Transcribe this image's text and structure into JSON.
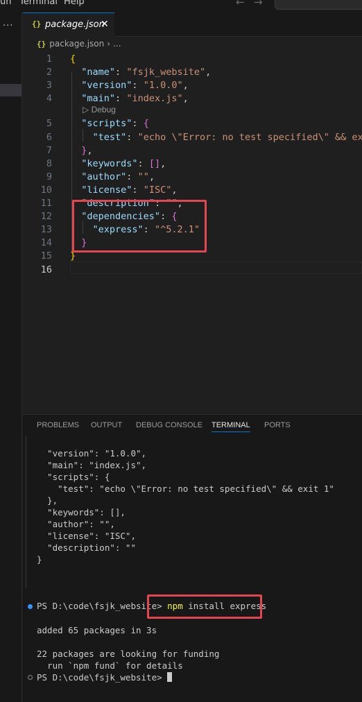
{
  "menu": {
    "run": "un",
    "terminal": "Terminal",
    "help": "Help"
  },
  "nav": {
    "back": "←",
    "forward": "→"
  },
  "sidebar": {
    "more": "..."
  },
  "tab": {
    "icon": "{}",
    "label": "package.json",
    "close": "✕"
  },
  "breadcrumb": {
    "icon": "{}",
    "file": "package.json",
    "sep": "›",
    "more": "..."
  },
  "codelens": {
    "debug": "Debug"
  },
  "editor_lines": [
    {
      "n": "1",
      "tokens": [
        {
          "t": "{",
          "c": "b1"
        }
      ]
    },
    {
      "n": "2",
      "tokens": [
        {
          "t": "  ",
          "c": "p"
        },
        {
          "t": "\"name\"",
          "c": "k"
        },
        {
          "t": ": ",
          "c": "p"
        },
        {
          "t": "\"fsjk_website\"",
          "c": "s"
        },
        {
          "t": ",",
          "c": "p"
        }
      ]
    },
    {
      "n": "3",
      "tokens": [
        {
          "t": "  ",
          "c": "p"
        },
        {
          "t": "\"version\"",
          "c": "k"
        },
        {
          "t": ": ",
          "c": "p"
        },
        {
          "t": "\"1.0.0\"",
          "c": "s"
        },
        {
          "t": ",",
          "c": "p"
        }
      ]
    },
    {
      "n": "4",
      "tokens": [
        {
          "t": "  ",
          "c": "p"
        },
        {
          "t": "\"main\"",
          "c": "k"
        },
        {
          "t": ": ",
          "c": "p"
        },
        {
          "t": "\"index.js\"",
          "c": "s"
        },
        {
          "t": ",",
          "c": "p"
        }
      ]
    },
    {
      "n": "5",
      "tokens": [
        {
          "t": "  ",
          "c": "p"
        },
        {
          "t": "\"scripts\"",
          "c": "k"
        },
        {
          "t": ": ",
          "c": "p"
        },
        {
          "t": "{",
          "c": "b2"
        }
      ]
    },
    {
      "n": "6",
      "tokens": [
        {
          "t": "    ",
          "c": "p"
        },
        {
          "t": "\"test\"",
          "c": "k"
        },
        {
          "t": ": ",
          "c": "p"
        },
        {
          "t": "\"echo \\\"Error: no test specified\\\" && exit",
          "c": "s"
        }
      ]
    },
    {
      "n": "7",
      "tokens": [
        {
          "t": "  ",
          "c": "p"
        },
        {
          "t": "}",
          "c": "b2"
        },
        {
          "t": ",",
          "c": "p"
        }
      ]
    },
    {
      "n": "8",
      "tokens": [
        {
          "t": "  ",
          "c": "p"
        },
        {
          "t": "\"keywords\"",
          "c": "k"
        },
        {
          "t": ": ",
          "c": "p"
        },
        {
          "t": "[]",
          "c": "b2"
        },
        {
          "t": ",",
          "c": "p"
        }
      ]
    },
    {
      "n": "9",
      "tokens": [
        {
          "t": "  ",
          "c": "p"
        },
        {
          "t": "\"author\"",
          "c": "k"
        },
        {
          "t": ": ",
          "c": "p"
        },
        {
          "t": "\"\"",
          "c": "s"
        },
        {
          "t": ",",
          "c": "p"
        }
      ]
    },
    {
      "n": "10",
      "tokens": [
        {
          "t": "  ",
          "c": "p"
        },
        {
          "t": "\"license\"",
          "c": "k"
        },
        {
          "t": ": ",
          "c": "p"
        },
        {
          "t": "\"ISC\"",
          "c": "s"
        },
        {
          "t": ",",
          "c": "p"
        }
      ]
    },
    {
      "n": "11",
      "tokens": [
        {
          "t": "  ",
          "c": "p"
        },
        {
          "t": "\"description\"",
          "c": "k"
        },
        {
          "t": ": ",
          "c": "p"
        },
        {
          "t": "\"\"",
          "c": "s"
        },
        {
          "t": ",",
          "c": "p"
        }
      ]
    },
    {
      "n": "12",
      "tokens": [
        {
          "t": "  ",
          "c": "p"
        },
        {
          "t": "\"dependencies\"",
          "c": "k"
        },
        {
          "t": ": ",
          "c": "p"
        },
        {
          "t": "{",
          "c": "b2"
        }
      ]
    },
    {
      "n": "13",
      "tokens": [
        {
          "t": "    ",
          "c": "p"
        },
        {
          "t": "\"express\"",
          "c": "k"
        },
        {
          "t": ": ",
          "c": "p"
        },
        {
          "t": "\"^5.2.1\"",
          "c": "s"
        }
      ]
    },
    {
      "n": "14",
      "tokens": [
        {
          "t": "  ",
          "c": "p"
        },
        {
          "t": "}",
          "c": "b2"
        }
      ]
    },
    {
      "n": "15",
      "tokens": [
        {
          "t": "}",
          "c": "b1"
        }
      ]
    },
    {
      "n": "16",
      "tokens": []
    }
  ],
  "panel": {
    "tabs": [
      "PROBLEMS",
      "OUTPUT",
      "DEBUG CONSOLE",
      "TERMINAL",
      "PORTS"
    ],
    "active_tab": "TERMINAL"
  },
  "terminal": {
    "output": [
      "  \"version\": \"1.0.0\",",
      "  \"main\": \"index.js\",",
      "  \"scripts\": {",
      "    \"test\": \"echo \\\"Error: no test specified\\\" && exit 1\"",
      "  },",
      "  \"keywords\": [],",
      "  \"author\": \"\",",
      "  \"license\": \"ISC\",",
      "  \"description\": \"\"",
      "}"
    ],
    "prompt": "PS D:\\code\\fsjk_website>",
    "cmd_npm": "npm",
    "cmd_rest": " install express",
    "added": "added 65 packages in 3s",
    "funding1": "22 packages are looking for funding",
    "funding2": "  run `npm fund` for details",
    "prompt2": "PS D:\\code\\fsjk_website>"
  },
  "colors": {
    "highlight": "#e2464e",
    "accent": "#0078d4",
    "json_key": "#9cdcfe",
    "json_string": "#ce9178"
  }
}
